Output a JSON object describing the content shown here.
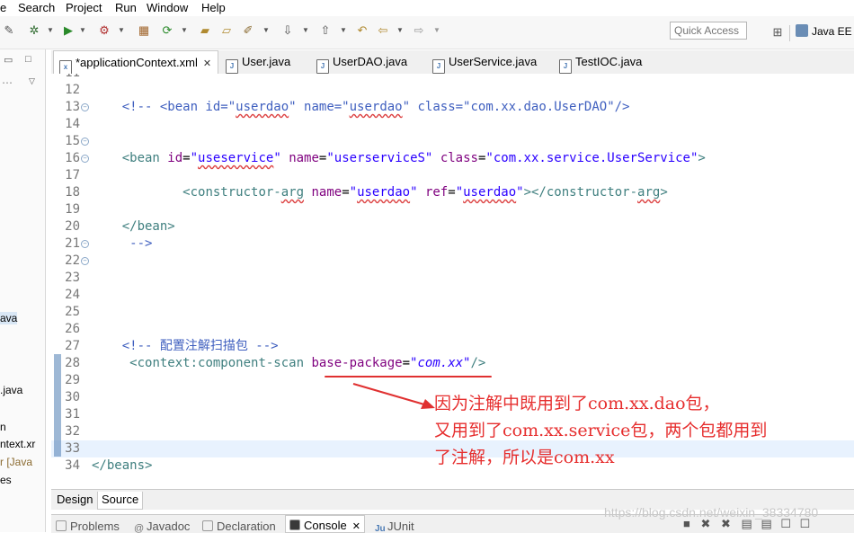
{
  "menu": [
    "e",
    "Search",
    "Project",
    "Run",
    "Window",
    "Help"
  ],
  "toolbar": {
    "quick_access_placeholder": "Quick Access",
    "perspective_label": "Java EE"
  },
  "left_pane": {
    "items": [
      "ava",
      ".java",
      "n",
      "ntext.xr",
      "r [Java",
      "es"
    ]
  },
  "editor_tabs": [
    {
      "label": "*applicationContext.xml",
      "active": true,
      "icon": "xml-file-icon"
    },
    {
      "label": "User.java",
      "active": false,
      "icon": "java-file-icon"
    },
    {
      "label": "UserDAO.java",
      "active": false,
      "icon": "java-file-icon"
    },
    {
      "label": "UserService.java",
      "active": false,
      "icon": "java-file-icon"
    },
    {
      "label": "TestIOC.java",
      "active": false,
      "icon": "java-file-icon"
    }
  ],
  "code_lines": [
    {
      "n": "11",
      "fold": false
    },
    {
      "n": "12",
      "fold": false
    },
    {
      "n": "13",
      "fold": true,
      "indent": "    ",
      "segments": [
        [
          "c-com",
          "<!-- <bean id=\""
        ],
        [
          "c-com sq",
          "userdao"
        ],
        [
          "c-com",
          "\" name=\""
        ],
        [
          "c-com sq",
          "userdao"
        ],
        [
          "c-com",
          "\" class=\"com.xx.dao.UserDAO\"/>"
        ]
      ]
    },
    {
      "n": "14",
      "fold": false
    },
    {
      "n": "15",
      "fold": true
    },
    {
      "n": "16",
      "fold": true,
      "indent": "    ",
      "segments": [
        [
          "c-tag",
          "<bean "
        ],
        [
          "c-attr",
          "id"
        ],
        [
          "",
          "="
        ],
        [
          "c-val",
          "\""
        ],
        [
          "c-val sq",
          "useservice"
        ],
        [
          "c-val",
          "\""
        ],
        [
          "",
          " "
        ],
        [
          "c-attr",
          "name"
        ],
        [
          "",
          "="
        ],
        [
          "c-val",
          "\"userserviceS\""
        ],
        [
          "",
          " "
        ],
        [
          "c-attr",
          "class"
        ],
        [
          "",
          "="
        ],
        [
          "c-val",
          "\"com.xx.service.UserService\""
        ],
        [
          "c-tag",
          ">"
        ]
      ]
    },
    {
      "n": "17",
      "fold": false
    },
    {
      "n": "18",
      "fold": false,
      "indent": "            ",
      "segments": [
        [
          "c-tag",
          "<constructor-"
        ],
        [
          "c-tag sq",
          "arg"
        ],
        [
          "",
          " "
        ],
        [
          "c-attr",
          "name"
        ],
        [
          "",
          "="
        ],
        [
          "c-val",
          "\""
        ],
        [
          "c-val sq",
          "userdao"
        ],
        [
          "c-val",
          "\""
        ],
        [
          "",
          " "
        ],
        [
          "c-attr",
          "ref"
        ],
        [
          "",
          "="
        ],
        [
          "c-val",
          "\""
        ],
        [
          "c-val sq",
          "userdao"
        ],
        [
          "c-val",
          "\""
        ],
        [
          "c-tag",
          "></constructor-"
        ],
        [
          "c-tag sq",
          "arg"
        ],
        [
          "c-tag",
          ">"
        ]
      ]
    },
    {
      "n": "19",
      "fold": false
    },
    {
      "n": "20",
      "fold": false,
      "indent": "    ",
      "segments": [
        [
          "c-tag",
          "</bean>"
        ]
      ]
    },
    {
      "n": "21",
      "fold": true,
      "indent": "     ",
      "segments": [
        [
          "c-com",
          "-->"
        ]
      ]
    },
    {
      "n": "22",
      "fold": true
    },
    {
      "n": "23",
      "fold": false
    },
    {
      "n": "24",
      "fold": false
    },
    {
      "n": "25",
      "fold": false
    },
    {
      "n": "26",
      "fold": false
    },
    {
      "n": "27",
      "fold": false,
      "indent": "    ",
      "segments": [
        [
          "c-com",
          "<!-- 配置注解扫描包 -->"
        ]
      ]
    },
    {
      "n": "28",
      "fold": false,
      "indent": "     ",
      "segments": [
        [
          "c-tag",
          "<context:component-scan "
        ],
        [
          "c-attr",
          "base-package"
        ],
        [
          "",
          "="
        ],
        [
          "c-val c-it",
          "\"com.xx\""
        ],
        [
          "c-tag",
          "/>"
        ]
      ]
    },
    {
      "n": "29",
      "fold": false
    },
    {
      "n": "30",
      "fold": false
    },
    {
      "n": "31",
      "fold": false
    },
    {
      "n": "32",
      "fold": false
    },
    {
      "n": "33",
      "fold": false,
      "current": true
    },
    {
      "n": "34",
      "fold": false,
      "indent": "",
      "segments": [
        [
          "c-tag",
          "</beans>"
        ]
      ]
    }
  ],
  "annotation": {
    "lines": [
      "因为注解中既用到了com.xx.dao包，",
      "又用到了com.xx.service包，两个包都用到",
      "了注解，所以是com.xx"
    ],
    "color": "#e62e2e"
  },
  "design_source_tabs": [
    {
      "label": "Design",
      "active": false
    },
    {
      "label": "Source",
      "active": true
    }
  ],
  "bottom_tabs": [
    {
      "label": "Problems",
      "active": false,
      "icon": "problems-icon"
    },
    {
      "label": "Javadoc",
      "active": false,
      "icon": "javadoc-icon"
    },
    {
      "label": "Declaration",
      "active": false,
      "icon": "declaration-icon"
    },
    {
      "label": "Console",
      "active": true,
      "icon": "console-icon"
    },
    {
      "label": "JUnit",
      "active": false,
      "icon": "junit-icon"
    }
  ],
  "watermark": "https://blog.csdn.net/weixin_38334780"
}
